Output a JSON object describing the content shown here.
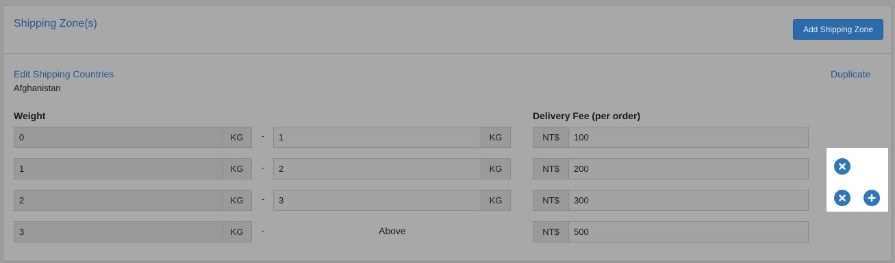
{
  "header": {
    "title": "Shipping Zone(s)",
    "add_button": "Add Shipping Zone"
  },
  "zone": {
    "edit_link": "Edit Shipping Countries",
    "duplicate_link": "Duplicate",
    "country": "Afghanistan"
  },
  "columns": {
    "weight": "Weight",
    "fee": "Delivery Fee (per order)"
  },
  "unit": "KG",
  "currency": "NT$",
  "separator": "-",
  "rows": [
    {
      "from": "0",
      "to": "1",
      "fee": "100"
    },
    {
      "from": "1",
      "to": "2",
      "fee": "200"
    },
    {
      "from": "2",
      "to": "3",
      "fee": "300"
    },
    {
      "from": "3",
      "to_label": "Above",
      "fee": "500"
    }
  ],
  "icons": {
    "remove": "close-circle-icon",
    "add": "plus-circle-icon"
  },
  "colors": {
    "accent": "#2c6bab",
    "link": "#1e5a93"
  }
}
